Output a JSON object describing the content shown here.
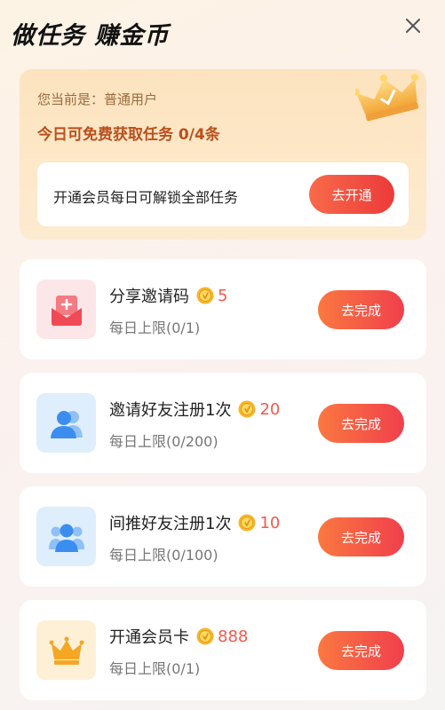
{
  "header": {
    "title": "做任务 赚金币"
  },
  "member": {
    "status_text": "您当前是：普通用户",
    "quota_text": "今日可免费获取任务 0/4条",
    "unlock_text": "开通会员每日可解锁全部任务",
    "open_button": "去开通"
  },
  "tasks": [
    {
      "name": "分享邀请码",
      "reward": "5",
      "limit": "每日上限(0/1)",
      "button": "去完成",
      "icon": "invite-envelope-icon"
    },
    {
      "name": "邀请好友注册1次",
      "reward": "20",
      "limit": "每日上限(0/200)",
      "button": "去完成",
      "icon": "friend-user-icon"
    },
    {
      "name": "间推好友注册1次",
      "reward": "10",
      "limit": "每日上限(0/100)",
      "button": "去完成",
      "icon": "friends-group-icon"
    },
    {
      "name": "开通会员卡",
      "reward": "888",
      "limit": "每日上限(0/1)",
      "button": "去完成",
      "icon": "crown-icon"
    }
  ],
  "colors": {
    "accent_red": "#ec3a3a",
    "reward_red": "#f05a4e",
    "member_brown": "#b9501c",
    "icon_blue": "#3b8ef0",
    "icon_pink": "#ef4a55",
    "icon_gold": "#f5a623"
  }
}
